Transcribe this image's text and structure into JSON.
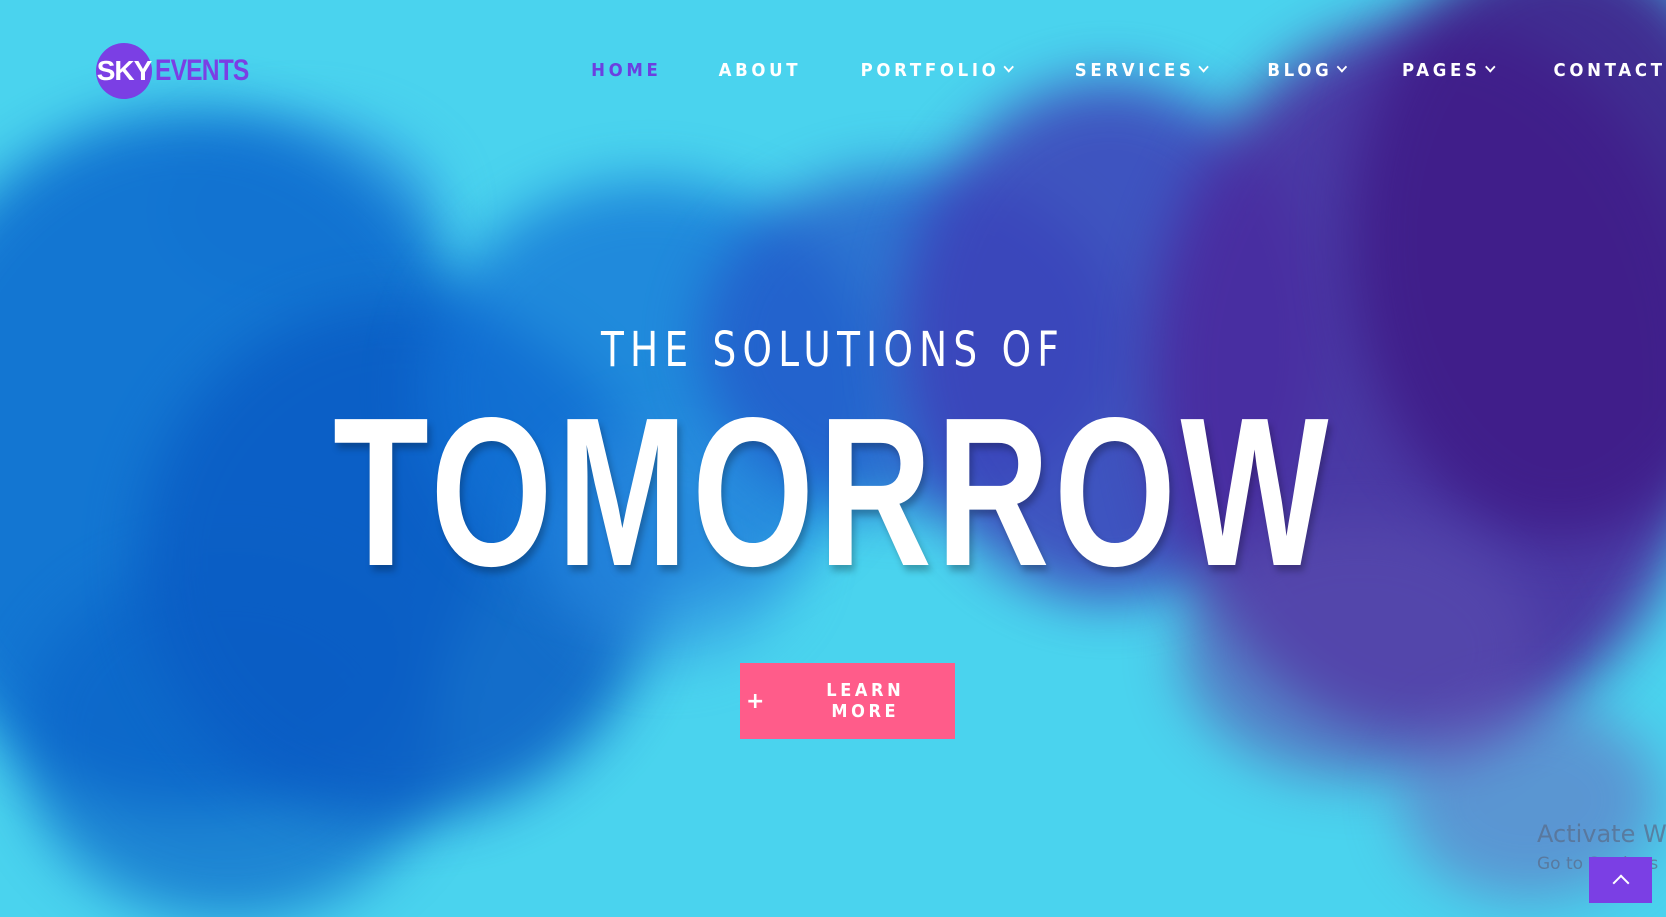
{
  "brand": {
    "logo_circle_text": "SKY",
    "logo_text": "EVENTS",
    "accent_color": "#7b3fe4"
  },
  "nav": {
    "items": [
      {
        "label": "HOME",
        "active": true,
        "dropdown": false
      },
      {
        "label": "ABOUT",
        "active": false,
        "dropdown": false
      },
      {
        "label": "PORTFOLIO",
        "active": false,
        "dropdown": true
      },
      {
        "label": "SERVICES",
        "active": false,
        "dropdown": true
      },
      {
        "label": "BLOG",
        "active": false,
        "dropdown": true
      },
      {
        "label": "PAGES",
        "active": false,
        "dropdown": true
      },
      {
        "label": "CONTACTS",
        "active": false,
        "dropdown": false
      }
    ]
  },
  "hero": {
    "subtitle": "THE SOLUTIONS OF",
    "title": "TOMORROW",
    "cta": {
      "icon": "plus-icon",
      "label": "LEARN MORE",
      "color": "#ff5c8a"
    },
    "background_color": "#4ad3ee"
  },
  "watermark": {
    "line1": "Activate Wi",
    "line2": "Go to Settings"
  },
  "scroll_top": {
    "icon": "chevron-up-icon"
  }
}
